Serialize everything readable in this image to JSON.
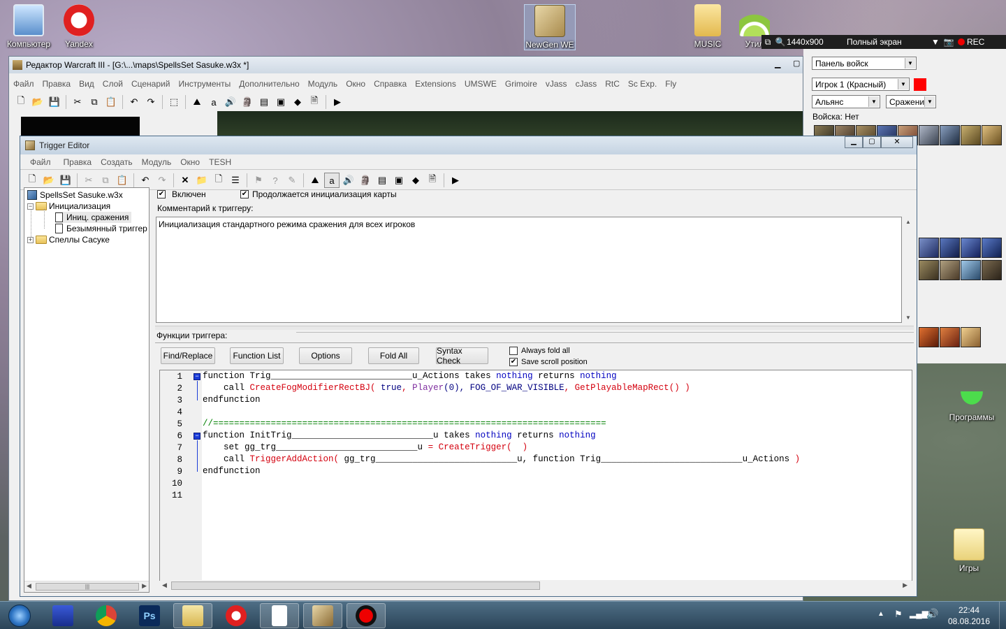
{
  "desktop": {
    "icons": [
      {
        "label": "Компьютер"
      },
      {
        "label": "Yandex"
      },
      {
        "label": "NewGen WE"
      },
      {
        "label": "MUSIC"
      },
      {
        "label": "Утил"
      },
      {
        "label": "Программы"
      },
      {
        "label": "Игры"
      }
    ]
  },
  "recorder": {
    "resolution": "1440x900",
    "mode": "Полный экран",
    "rec_label": "REC"
  },
  "we_window": {
    "title": "Редактор Warcraft III  - [G:\\...\\maps\\SpellsSet Sasuke.w3x *]",
    "menu": [
      "Файл",
      "Правка",
      "Вид",
      "Слой",
      "Сценарий",
      "Инструменты",
      "Дополнительно",
      "Модуль",
      "Окно",
      "Справка",
      "Extensions",
      "UMSWE",
      "Grimoire",
      "vJass",
      "cJass",
      "RtC",
      "Sc Exp.",
      "Fly"
    ]
  },
  "right_panel": {
    "palette_select": "Панель войск",
    "player_select": "Игрок 1 (Красный)",
    "player_color": "#ff0000",
    "race_select": "Альянс",
    "mode_select": "Сражение",
    "troops_label": "Войска: Нет"
  },
  "trigger_editor": {
    "title": "Trigger Editor",
    "menu": [
      "Файл",
      "Правка",
      "Создать",
      "Модуль",
      "Окно",
      "TESH"
    ],
    "tree": {
      "root": "SpellsSet Sasuke.w3x",
      "folder1": "Инициализация",
      "item1": "Иниц. сражения",
      "item2": "Безымянный триггер 00",
      "folder2": "Спеллы Сасуке"
    },
    "enabled_label": "Включен",
    "continue_init_label": "Продолжается инициализация карты",
    "comment_label": "Комментарий к триггеру:",
    "comment_text": "Инициализация стандартного режима сражения для всех игроков",
    "functions_label": "Функции триггера:",
    "buttons": {
      "find_replace": "Find/Replace",
      "function_list": "Function List",
      "options": "Options",
      "fold_all": "Fold All",
      "syntax_check": "Syntax Check"
    },
    "always_fold_label": "Always fold all",
    "save_scroll_label": "Save scroll position",
    "line_numbers": [
      "1",
      "2",
      "3",
      "4",
      "5",
      "6",
      "7",
      "8",
      "9",
      "10",
      "11"
    ],
    "code": {
      "l1_kw": "function",
      "l1_name": " Trig___________________________u_Actions ",
      "l1_takes": "takes ",
      "l1_nothing1": "nothing",
      "l1_returns": " returns ",
      "l1_nothing2": "nothing",
      "l2_call": "    call ",
      "l2_fn": "CreateFogModifierRectBJ( ",
      "l2_true": "true",
      "l2_c1": ", ",
      "l2_player": "Player",
      "l2_p0": "(0), ",
      "l2_fog": "FOG_OF_WAR_VISIBLE",
      "l2_c2": ", ",
      "l2_gpmr": "GetPlayableMapRect",
      "l2_end": "() )",
      "l3": "endfunction",
      "l5": "//===========================================================================",
      "l6_kw": "function",
      "l6_name": " InitTrig___________________________u ",
      "l6_takes": "takes ",
      "l6_nothing1": "nothing",
      "l6_returns": " returns ",
      "l6_nothing2": "nothing",
      "l7_set": "    set ",
      "l7_var": "gg_trg___________________________u",
      "l7_eq": " = ",
      "l7_fn": "CreateTrigger(  )",
      "l8_call": "    call ",
      "l8_fn": "TriggerAddAction( ",
      "l8_args": "gg_trg___________________________u, ",
      "l8_kw": "function",
      "l8_ref": " Trig___________________________u_Actions ",
      "l8_close": ")",
      "l9": "endfunction"
    }
  },
  "taskbar": {
    "time": "22:44",
    "date": "08.08.2016"
  }
}
